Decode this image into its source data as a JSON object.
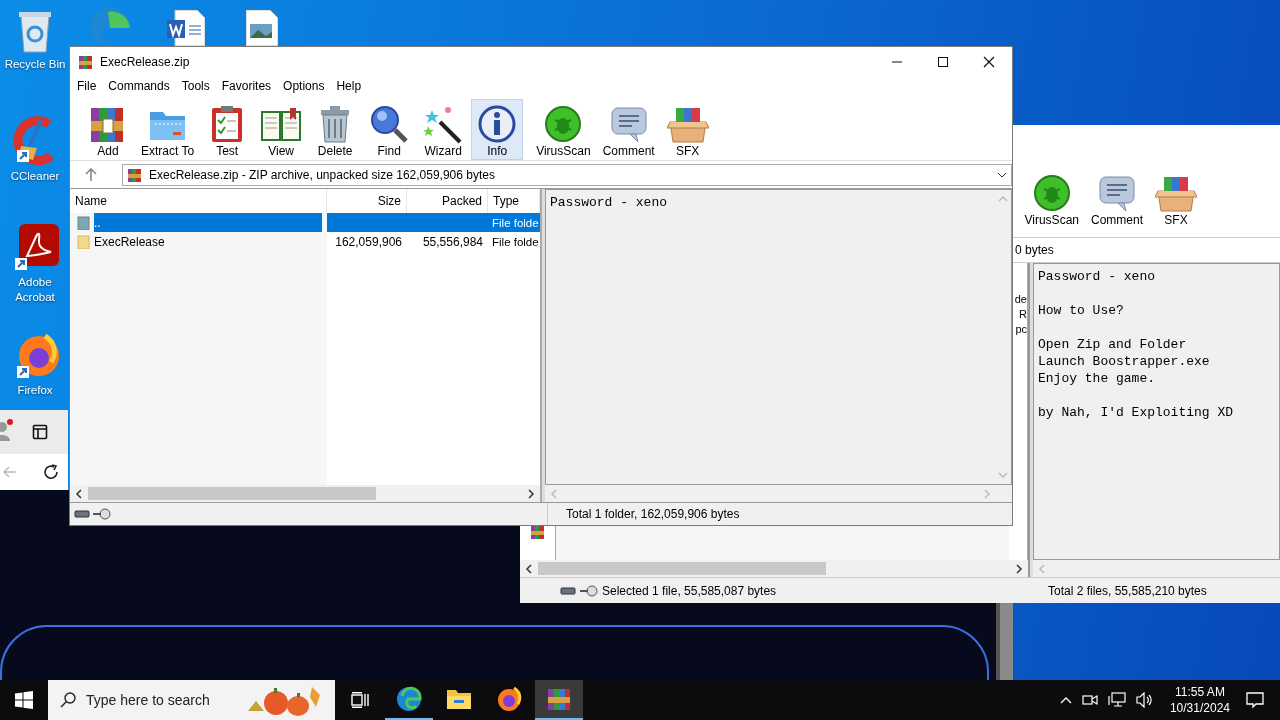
{
  "desktop_icons": [
    {
      "label": "Recycle Bin"
    },
    {
      "label": "CCleaner"
    },
    {
      "label": "Adobe Acrobat"
    },
    {
      "label": "Firefox"
    }
  ],
  "back_window": {
    "toolbar": [
      {
        "label": "VirusScan"
      },
      {
        "label": "Comment"
      },
      {
        "label": "SFX"
      }
    ],
    "address": "0 bytes",
    "column_fragments": [
      "de",
      "R",
      "pc"
    ],
    "comment": [
      [
        "Password - xeno"
      ],
      [
        "How to Use?"
      ],
      [
        "Open Zip and Folder",
        "Launch Boostrapper.exe",
        "Enjoy the game."
      ],
      [
        "by Nah, I'd Exploiting XD"
      ]
    ],
    "status_left": "Selected 1 file, 55,585,087 bytes",
    "status_right": "Total 2 files, 55,585,210 bytes"
  },
  "main_window": {
    "title": "ExecRelease.zip",
    "menu": [
      "File",
      "Commands",
      "Tools",
      "Favorites",
      "Options",
      "Help"
    ],
    "toolbar": [
      {
        "label": "Add",
        "selected": false
      },
      {
        "label": "Extract To",
        "selected": false
      },
      {
        "label": "Test",
        "selected": false
      },
      {
        "label": "View",
        "selected": false
      },
      {
        "label": "Delete",
        "selected": false
      },
      {
        "label": "Find",
        "selected": false
      },
      {
        "label": "Wizard",
        "selected": false
      },
      {
        "label": "Info",
        "selected": true
      },
      {
        "label": "VirusScan",
        "selected": false
      },
      {
        "label": "Comment",
        "selected": false
      },
      {
        "label": "SFX",
        "selected": false
      }
    ],
    "address": "ExecRelease.zip - ZIP archive, unpacked size 162,059,906 bytes",
    "columns": [
      "Name",
      "Size",
      "Packed",
      "Type"
    ],
    "rows": [
      {
        "name": "..",
        "size": "",
        "packed": "",
        "type": "File folde",
        "selected": true
      },
      {
        "name": "ExecRelease",
        "size": "162,059,906",
        "packed": "55,556,984",
        "type": "File folde",
        "selected": false
      }
    ],
    "comment": [
      "Password - xeno"
    ],
    "status": "Total 1 folder, 162,059,906 bytes"
  },
  "taskbar": {
    "search": {
      "placeholder": "Type here to search"
    },
    "time": "11:55 AM",
    "date": "10/31/2024"
  }
}
